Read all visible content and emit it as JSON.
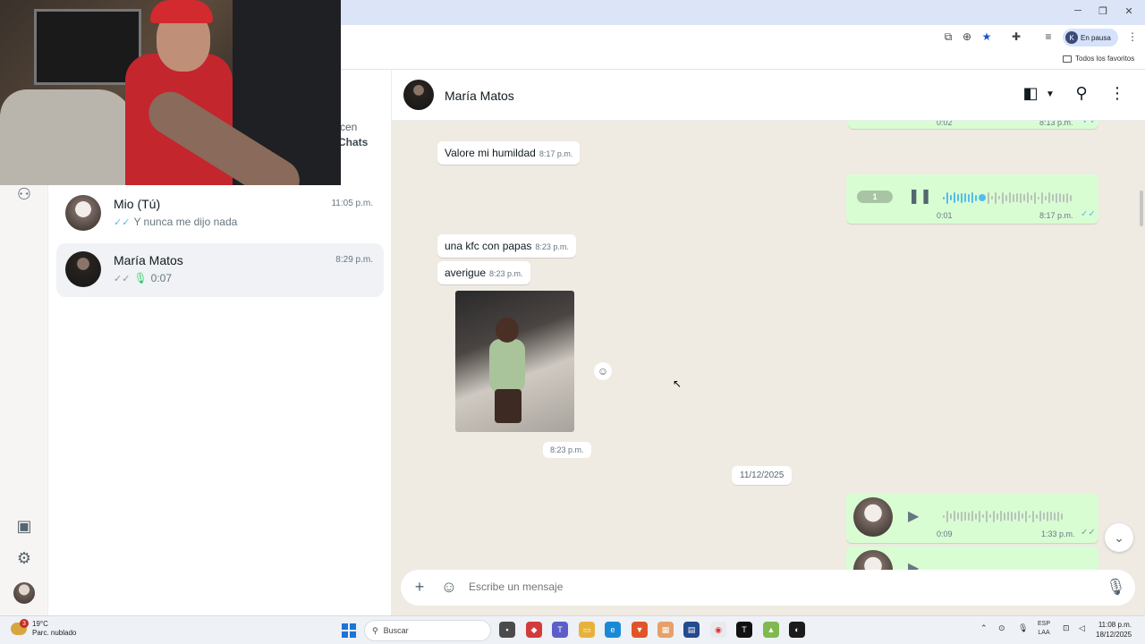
{
  "browser": {
    "window_controls": {
      "minimize": "─",
      "restore": "❐",
      "close": "✕"
    },
    "profile": {
      "initial": "K",
      "status": "En pausa"
    },
    "bookmarks_folder": "Todos los favoritos",
    "toolbar_icons": [
      "screen-cast-icon",
      "zoom-icon",
      "star-icon",
      "extensions-icon",
      "media-icon",
      "menu-icon"
    ]
  },
  "sidebar": {
    "clipped_text_1": "cen",
    "clipped_text_2": "Chats",
    "chats": [
      {
        "name": "Mio (Tú)",
        "time": "11:05 p.m.",
        "preview": "Y nunca me dijo nada",
        "ticks": "✓✓"
      },
      {
        "name": "María Matos",
        "time": "8:29 p.m.",
        "preview": "0:07",
        "ticks": "✓✓"
      }
    ]
  },
  "conversation": {
    "contact_name": "María Matos",
    "messages": {
      "top_voice": {
        "duration": "0:02",
        "time": "8:13 p.m."
      },
      "text1": {
        "text": "Valore mi humildad",
        "time": "8:17 p.m."
      },
      "voice_playing": {
        "speed": "1",
        "duration": "0:01",
        "time": "8:17 p.m."
      },
      "text2": {
        "text": "una kfc con papas",
        "time": "8:23 p.m."
      },
      "text3": {
        "text": "averigue",
        "time": "8:23 p.m."
      },
      "image_time": "8:23 p.m.",
      "date_separator": "11/12/2025",
      "voice3": {
        "duration": "0:09",
        "time": "1:33 p.m."
      }
    },
    "composer": {
      "placeholder": "Escribe un mensaje"
    }
  },
  "taskbar": {
    "weather": {
      "temp": "19°C",
      "condition": "Parc. nublado",
      "badge": "3"
    },
    "search_label": "Buscar",
    "language": {
      "line1": "ESP",
      "line2": "LAA"
    },
    "clock": {
      "time": "11:08 p.m.",
      "date": "18/12/2025"
    }
  },
  "colors": {
    "outgoing_bubble": "#d9fdd3",
    "chat_background": "#efeae2",
    "read_ticks": "#53bdeb",
    "whatsapp_green": "#25d366"
  }
}
